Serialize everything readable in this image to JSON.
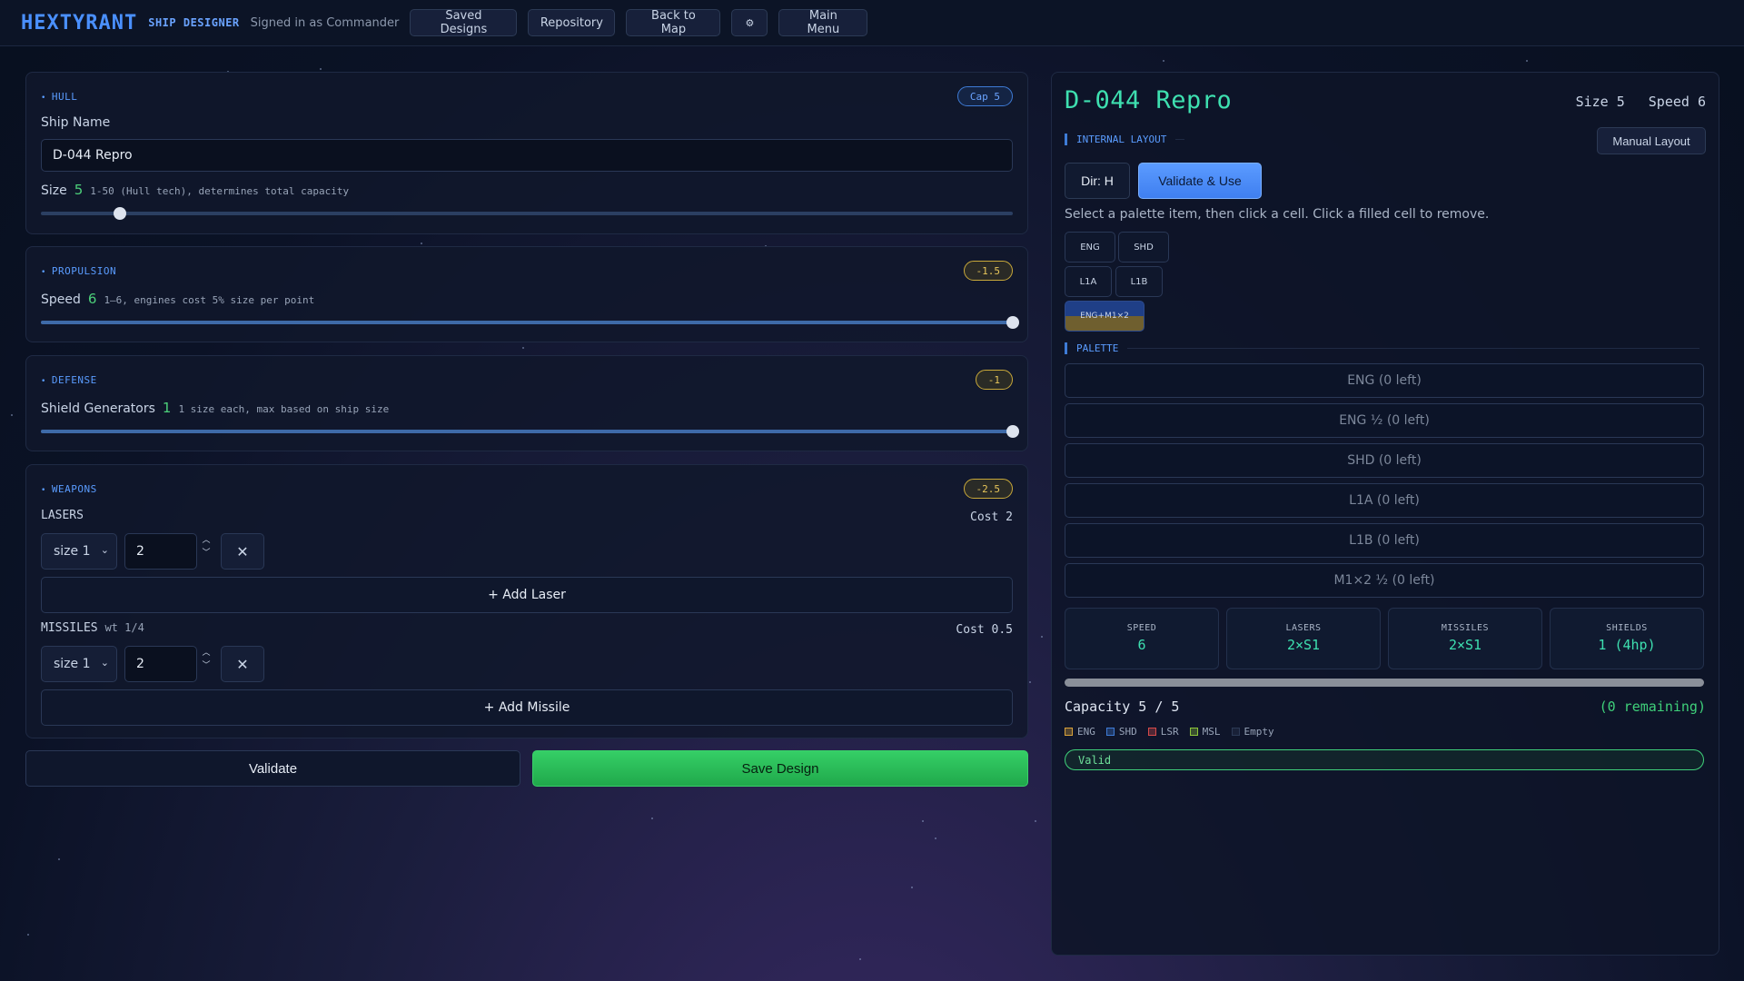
{
  "topbar": {
    "logo": "HEXTYRANT",
    "subtitle": "SHIP DESIGNER",
    "signed_in": "Signed in as Commander",
    "buttons": {
      "saved_designs": "Saved Designs",
      "repository": "Repository",
      "back_to_map": "Back to Map",
      "settings": "⚙",
      "main_menu": "Main Menu"
    }
  },
  "hull": {
    "title": "HULL",
    "badge": "Cap 5",
    "ship_name_label": "Ship Name",
    "ship_name_value": "D-044 Repro",
    "size_label": "Size",
    "size_value": "5",
    "size_hint": "1-50 (Hull tech), determines total capacity",
    "size_range": [
      1,
      50
    ],
    "size_fraction": 0.0816
  },
  "propulsion": {
    "title": "PROPULSION",
    "badge": "-1.5",
    "speed_label": "Speed",
    "speed_value": "6",
    "speed_hint": "1–6, engines cost 5% size per point",
    "speed_fraction": 1.0
  },
  "defense": {
    "title": "DEFENSE",
    "badge": "-1",
    "shield_label": "Shield Generators",
    "shield_value": "1",
    "shield_hint": "1 size each, max based on ship size",
    "shield_fraction": 1.0
  },
  "weapons": {
    "title": "WEAPONS",
    "badge": "-2.5",
    "lasers": {
      "label": "LASERS",
      "cost": "Cost 2",
      "size_select": "size 1",
      "count": "2",
      "add_label": "+ Add Laser"
    },
    "missiles": {
      "label": "MISSILES",
      "weight": "wt 1/4",
      "cost": "Cost 0.5",
      "size_select": "size 1",
      "count": "2",
      "add_label": "+ Add Missile"
    }
  },
  "actions": {
    "validate": "Validate",
    "save": "Save Design"
  },
  "preview": {
    "ship_name": "D-044 Repro",
    "size_stat": "Size 5",
    "speed_stat": "Speed 6",
    "internal_layout_title": "INTERNAL LAYOUT",
    "manual_layout": "Manual Layout",
    "dir_button": "Dir: H",
    "validate_use": "Validate & Use",
    "instructions": "Select a palette item, then click a cell. Click a filled cell to remove.",
    "grid_cells": [
      "ENG",
      "SHD",
      "L1A",
      "L1B",
      "ENG+M1×2"
    ],
    "palette_title": "PALETTE",
    "palette_items": [
      "ENG (0 left)",
      "ENG ½ (0 left)",
      "SHD (0 left)",
      "L1A (0 left)",
      "L1B (0 left)",
      "M1×2 ½ (0 left)"
    ],
    "stats": [
      {
        "title": "SPEED",
        "value": "6"
      },
      {
        "title": "LASERS",
        "value": "2×S1"
      },
      {
        "title": "MISSILES",
        "value": "2×S1"
      },
      {
        "title": "SHIELDS",
        "value": "1 (4hp)"
      }
    ],
    "capacity_fraction": 1.0,
    "capacity_text": "Capacity 5 / 5",
    "capacity_remaining": "(0 remaining)",
    "legend": [
      {
        "label": "ENG",
        "color": "#d9a23a"
      },
      {
        "label": "SHD",
        "color": "#3e7bd6"
      },
      {
        "label": "LSR",
        "color": "#d64a4a"
      },
      {
        "label": "MSL",
        "color": "#8cc43a"
      },
      {
        "label": "Empty",
        "color": "#2c3a55"
      }
    ],
    "status": "Valid"
  }
}
